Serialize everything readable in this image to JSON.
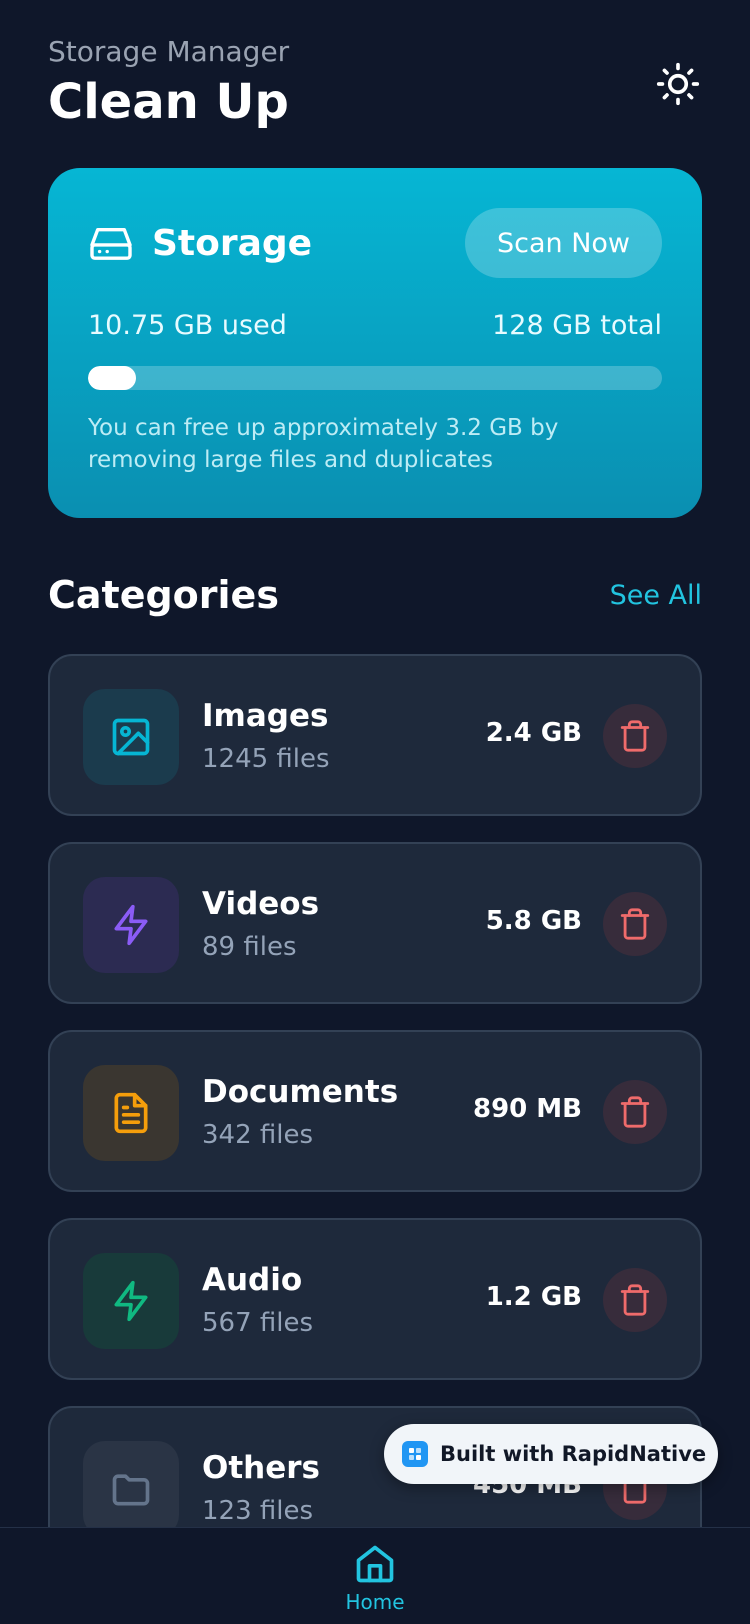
{
  "header": {
    "subtitle": "Storage Manager",
    "title": "Clean Up",
    "theme_icon": "sun-icon"
  },
  "storage": {
    "title": "Storage",
    "icon": "hard-drive-icon",
    "scan_label": "Scan Now",
    "used_label": "10.75 GB used",
    "total_label": "128 GB total",
    "used_fraction": 0.084,
    "hint": "You can free up approximately 3.2 GB by removing large files and duplicates",
    "gradient_top": "#06b6d4",
    "gradient_bottom": "#0a8fb1"
  },
  "categories_section": {
    "title": "Categories",
    "see_all_label": "See All"
  },
  "categories": [
    {
      "name": "Images",
      "count": "1245 files",
      "size": "2.4 GB",
      "icon": "image-icon",
      "color": "#06b6d4",
      "tile": "#1b3b4d"
    },
    {
      "name": "Videos",
      "count": "89 files",
      "size": "5.8 GB",
      "icon": "bolt-icon",
      "color": "#8b5cf6",
      "tile": "#2c2b52"
    },
    {
      "name": "Documents",
      "count": "342 files",
      "size": "890 MB",
      "icon": "document-icon",
      "color": "#f59e0b",
      "tile": "#3a3630"
    },
    {
      "name": "Audio",
      "count": "567 files",
      "size": "1.2 GB",
      "icon": "bolt-icon",
      "color": "#10b981",
      "tile": "#183a3a"
    },
    {
      "name": "Others",
      "count": "123 files",
      "size": "450 MB",
      "icon": "folder-icon",
      "color": "#64748b",
      "tile": "#2a3445"
    }
  ],
  "badge": {
    "label": "Built with RapidNative"
  },
  "nav": {
    "home_label": "Home",
    "accent": "#22c4e0"
  }
}
